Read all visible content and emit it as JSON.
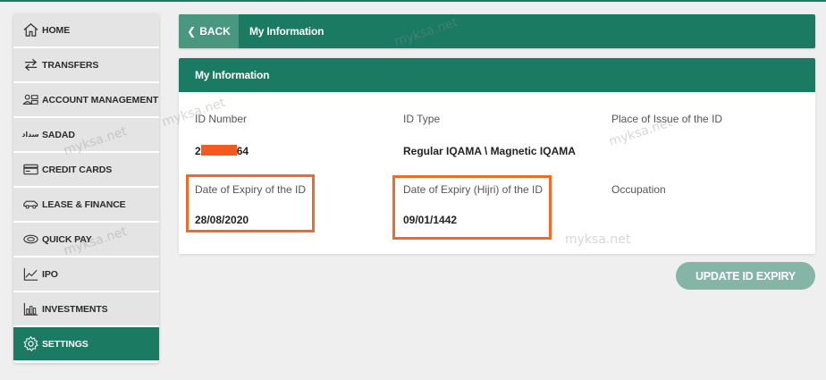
{
  "sidebar": {
    "items": [
      {
        "label": "HOME",
        "icon": "home-icon"
      },
      {
        "label": "TRANSFERS",
        "icon": "transfer-arrows-icon"
      },
      {
        "label": "ACCOUNT MANAGEMENT",
        "icon": "account-users-icon"
      },
      {
        "label": "SADAD",
        "icon": "sadad-logo-icon",
        "mark": "سداد"
      },
      {
        "label": "CREDIT CARDS",
        "icon": "credit-card-icon"
      },
      {
        "label": "LEASE & FINANCE",
        "icon": "car-icon"
      },
      {
        "label": "QUICK PAY",
        "icon": "quick-pay-icon"
      },
      {
        "label": "IPO",
        "icon": "chart-trend-icon"
      },
      {
        "label": "INVESTMENTS",
        "icon": "bar-chart-icon"
      },
      {
        "label": "SETTINGS",
        "icon": "gear-icon",
        "active": true
      }
    ]
  },
  "header": {
    "back_label": "BACK",
    "title": "My Information"
  },
  "card": {
    "title": "My Information",
    "fields": {
      "id_number": {
        "label": "ID Number",
        "value_prefix": "2",
        "value_suffix": "64"
      },
      "id_type": {
        "label": "ID Type",
        "value": "Regular IQAMA \\ Magnetic IQAMA"
      },
      "place_of_issue": {
        "label": "Place of Issue of the ID",
        "value": ""
      },
      "expiry_date": {
        "label": "Date of Expiry of the ID",
        "value": "28/08/2020"
      },
      "expiry_hijri": {
        "label": "Date of Expiry (Hijri) of the ID",
        "value": "09/01/1442"
      },
      "occupation": {
        "label": "Occupation",
        "value": ""
      }
    }
  },
  "update_button_label": "UPDATE ID EXPIRY",
  "watermark": "myksa.net",
  "colors": {
    "primary": "#1a7a62",
    "back_button": "#4a977f",
    "update_button": "#84b5a6",
    "highlight": "#ee6b2a",
    "redaction": "#f25a1f"
  }
}
